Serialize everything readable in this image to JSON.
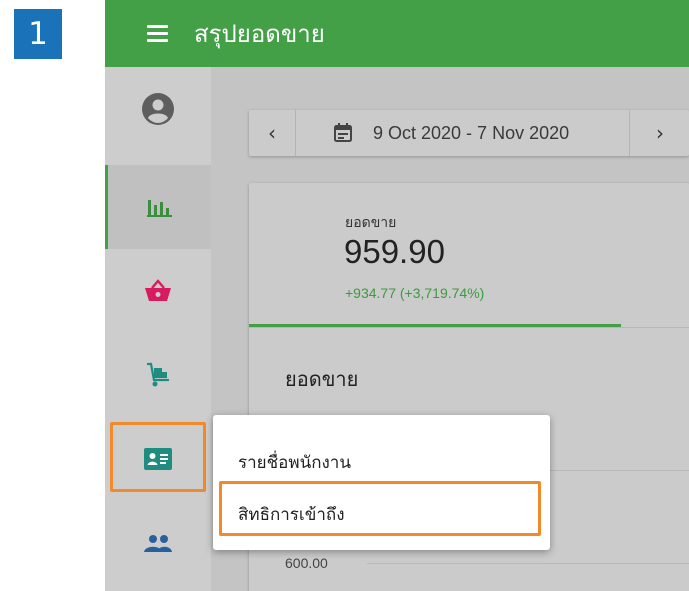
{
  "step": {
    "number": "1"
  },
  "header": {
    "title": "สรุปยอดขาย"
  },
  "sidebar": {
    "items": [
      {
        "icon": "account-circle-icon"
      },
      {
        "icon": "bar-chart-icon",
        "active": true
      },
      {
        "icon": "basket-icon"
      },
      {
        "icon": "hand-truck-icon"
      },
      {
        "icon": "id-card-icon",
        "highlighted": true
      },
      {
        "icon": "group-icon"
      }
    ]
  },
  "date_range": {
    "prev": "‹",
    "label": "9 Oct 2020 - 7 Nov 2020",
    "next": "›"
  },
  "kpi": {
    "label": "ยอดขาย",
    "value": "959.90",
    "change": "+934.77 (+3,719.74%)"
  },
  "chart": {
    "title": "ยอดขาย",
    "axis_label": "600.00"
  },
  "menu": {
    "items": [
      {
        "label": "รายชื่อพนักงาน"
      },
      {
        "label": "สิทธิการเข้าถึง",
        "highlighted": true
      }
    ]
  },
  "colors": {
    "accent": "#43a047",
    "highlight": "#f08a2a",
    "badge": "#1a73b8",
    "basket": "#d81b60",
    "icon_teal": "#1e8c7e"
  }
}
